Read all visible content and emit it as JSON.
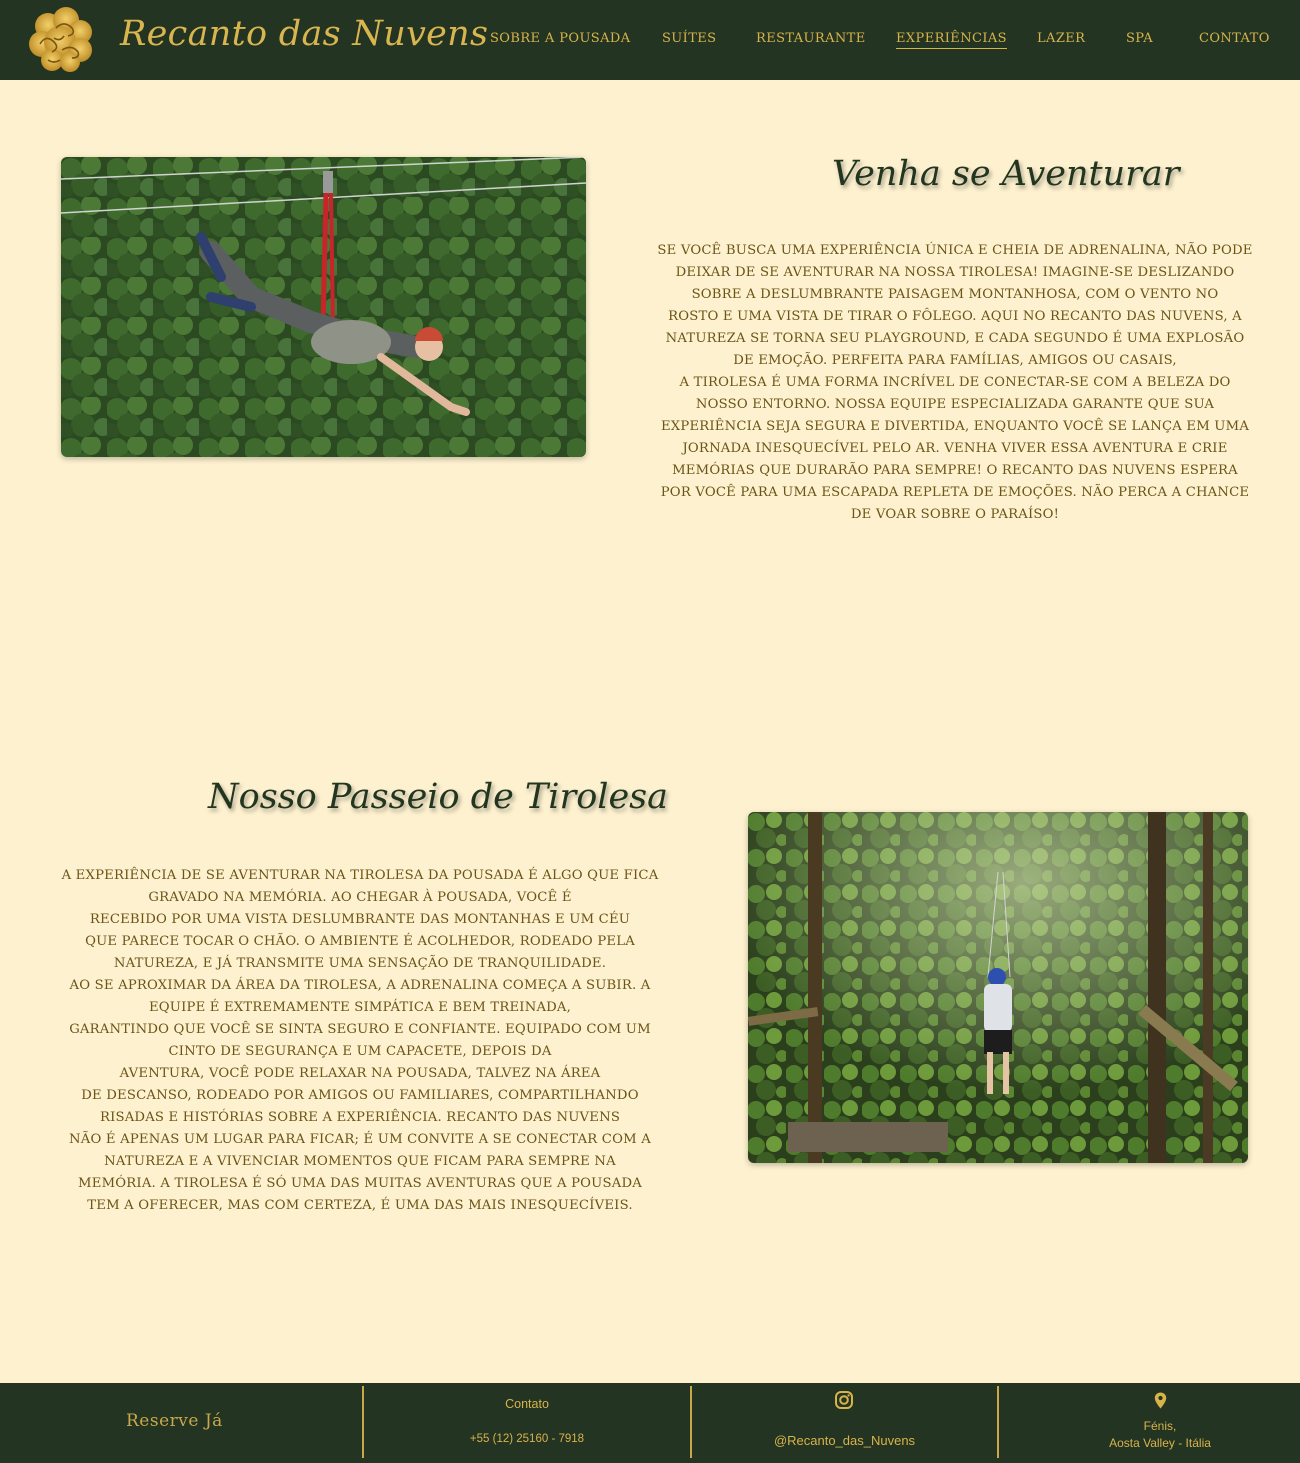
{
  "header": {
    "brand": "Recanto das Nuvens",
    "logo_icon": "golden-cloud-emblem",
    "nav": [
      {
        "label": "Sobre a Pousada"
      },
      {
        "label": "Suítes"
      },
      {
        "label": "Restaurante"
      },
      {
        "label": "Experiências",
        "active": true
      },
      {
        "label": "Lazer"
      },
      {
        "label": "Spa"
      },
      {
        "label": "Contato"
      }
    ]
  },
  "section1": {
    "title": "Venha se Aventurar",
    "lines": [
      "Se você busca uma experiência única e cheia de adrenalina, não pode",
      "deixar de se aventurar na nossa tirolesa! Imagine-se deslizando",
      "sobre a deslumbrante paisagem montanhosa, com o vento no",
      "rosto e uma vista de tirar o fôlego. Aqui no Recanto das Nuvens, a",
      "natureza se torna seu playground, e cada segundo é uma explosão",
      "de emoção. Perfeita para famílias, amigos ou casais,",
      "a tirolesa é uma forma incrível de conectar-se com a beleza do",
      "nosso entorno. Nossa equipe especializada garante que sua",
      "experiência seja segura e divertida, enquanto você se lança em uma",
      "jornada inesquecível pelo ar. Venha viver  essa aventura e crie",
      "memórias que durarão para sempre! O Recanto das Nuvens espera",
      "por você para uma escapada repleta de emoções. Não perca a chance",
      "de voar sobre o paraíso!"
    ]
  },
  "section2": {
    "title": "Nosso Passeio de Tirolesa",
    "lines": [
      "A experiência de se aventurar na tirolesa da pousada  é algo que fica",
      "gravado na memória. Ao chegar à pousada, você é",
      "recebido por uma vista deslumbrante das montanhas e um céu",
      "que parece tocar o chão. O ambiente é acolhedor, rodeado pela",
      "natureza, e já transmite uma sensação de tranquilidade.",
      "Ao se aproximar da área da tirolesa, a adrenalina começa a subir. A",
      "equipe é extremamente simpática e bem treinada,",
      "garantindo que você se sinta seguro e confiante. Equipado com um",
      "cinto de segurança e um capacete, depois da",
      "aventura, você pode relaxar na pousada, talvez na área",
      "de descanso, rodeado por amigos ou familiares, compartilhando",
      "risadas e histórias sobre a experiência. Recanto das Nuvens",
      "não é apenas um lugar para ficar; é um convite a se conectar com a",
      "natureza e a vivenciar momentos que ficam para sempre na",
      "memória. A tirolesa é só uma das muitas aventuras que a pousada",
      "tem a oferecer, mas com certeza, é uma das mais inesquecíveis."
    ]
  },
  "footer": {
    "reserve_label": "Reserve Já",
    "contact_title": "Contato",
    "phone": "+55 (12) 25160 - 7918",
    "instagram_icon": "instagram-icon",
    "instagram_handle": "@Recanto_das_Nuvens",
    "location_icon": "map-pin-icon",
    "location_line1": "Fénis,",
    "location_line2": "Aosta Valley -  Itália"
  },
  "colors": {
    "header_bg": "#233423",
    "page_bg": "#fdf1cf",
    "gold": "#d7b34a",
    "text_brown": "#6b5416",
    "title_green": "#22351f"
  }
}
